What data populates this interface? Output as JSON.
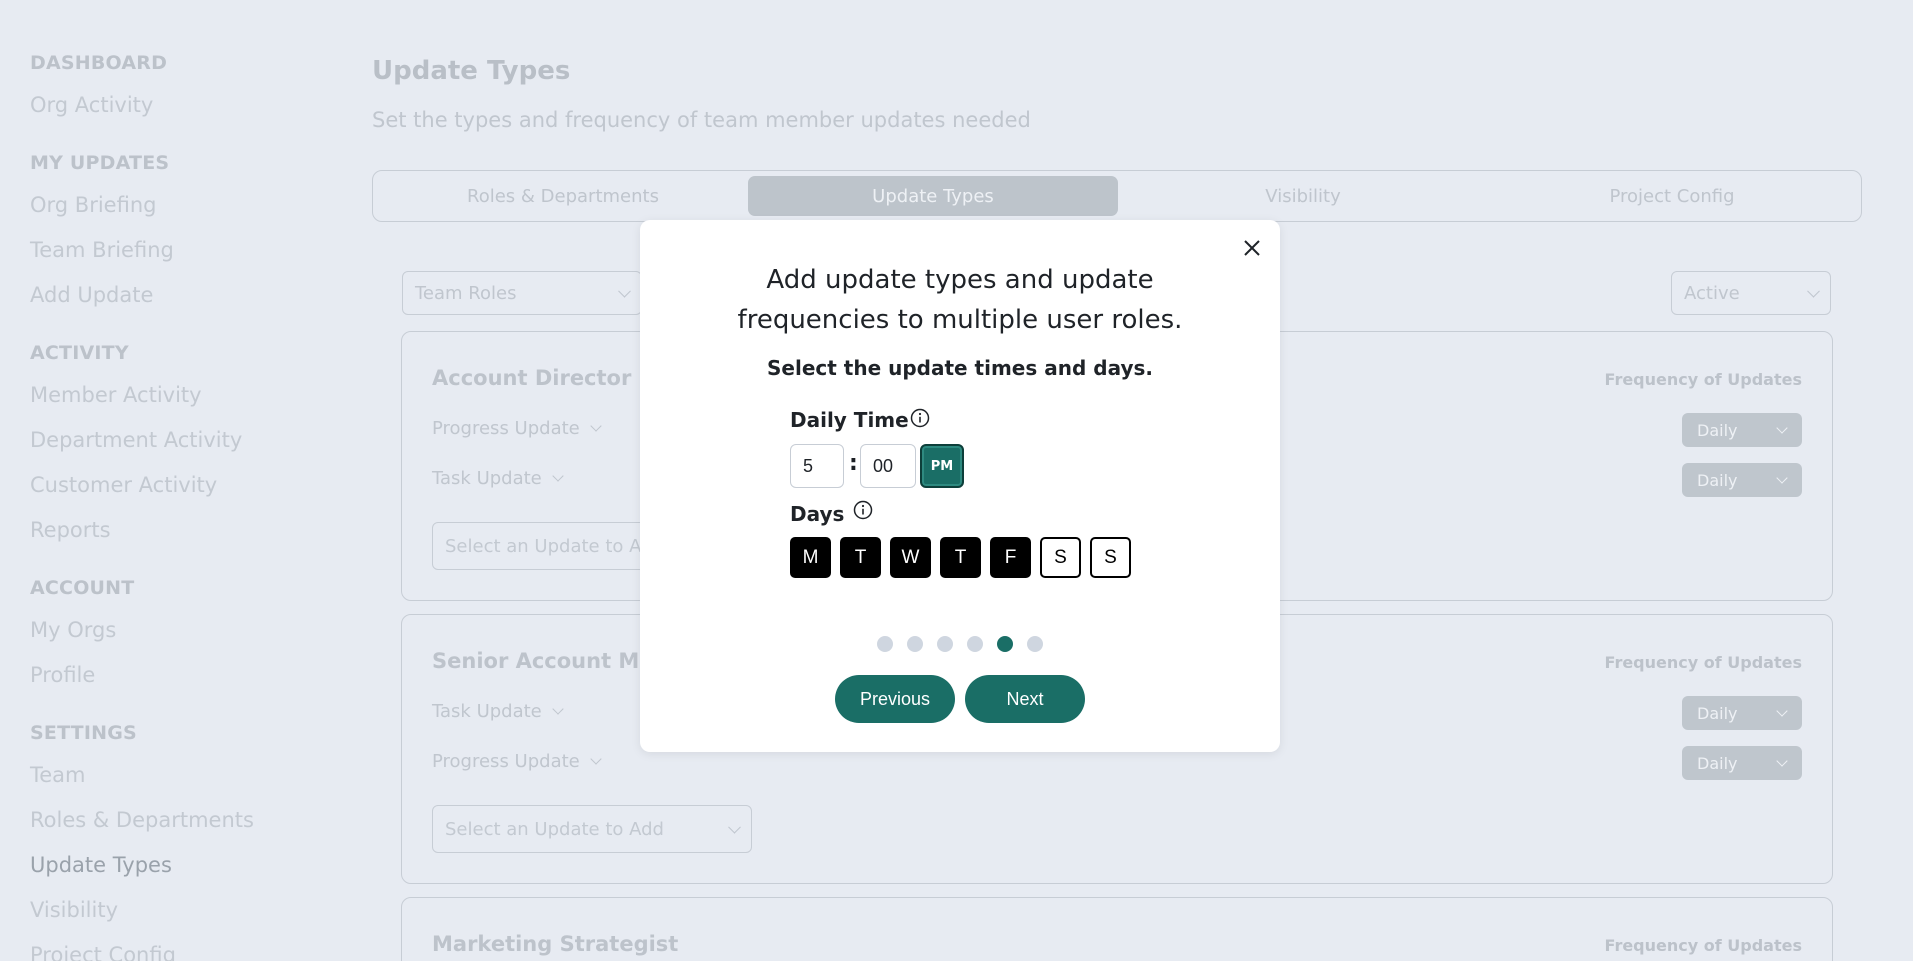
{
  "sidebar": {
    "sections": [
      {
        "heading": "DASHBOARD",
        "items": [
          "Org Activity"
        ]
      },
      {
        "heading": "MY UPDATES",
        "items": [
          "Org Briefing",
          "Team Briefing",
          "Add Update"
        ]
      },
      {
        "heading": "ACTIVITY",
        "items": [
          "Member Activity",
          "Department Activity",
          "Customer Activity",
          "Reports"
        ]
      },
      {
        "heading": "ACCOUNT",
        "items": [
          "My Orgs",
          "Profile"
        ]
      },
      {
        "heading": "SETTINGS",
        "items": [
          "Team",
          "Roles & Departments",
          "Update Types",
          "Visibility",
          "Project Config"
        ]
      }
    ],
    "active_item": "Update Types"
  },
  "header": {
    "title": "Update Types",
    "subtitle": "Set the types and frequency of team member updates needed"
  },
  "tabs": [
    "Roles & Departments",
    "Update Types",
    "Visibility",
    "Project Config"
  ],
  "active_tab": "Update Types",
  "filters": {
    "role_filter": "Team Roles",
    "status_filter": "Active"
  },
  "cards": [
    {
      "title": "Account Director",
      "frequency_label": "Frequency of Updates",
      "updates": [
        {
          "name": "Progress Update",
          "frequency": "Daily"
        },
        {
          "name": "Task Update",
          "frequency": "Daily"
        }
      ],
      "add_placeholder": "Select an Update to Add"
    },
    {
      "title": "Senior Account Manager",
      "frequency_label": "Frequency of Updates",
      "updates": [
        {
          "name": "Task Update",
          "frequency": "Daily"
        },
        {
          "name": "Progress Update",
          "frequency": "Daily"
        }
      ],
      "add_placeholder": "Select an Update to Add"
    },
    {
      "title": "Marketing Strategist",
      "frequency_label": "Frequency of Updates"
    }
  ],
  "modal": {
    "title_line1": "Add update types and update",
    "title_line2": "frequencies to multiple user roles.",
    "subtitle": "Select the update times and days.",
    "daily_time_label": "Daily Time",
    "hour": "5",
    "separator": ":",
    "minute": "00",
    "meridiem": "PM",
    "days_label": "Days",
    "days": [
      {
        "label": "M",
        "selected": true
      },
      {
        "label": "T",
        "selected": true
      },
      {
        "label": "W",
        "selected": true
      },
      {
        "label": "T",
        "selected": true
      },
      {
        "label": "F",
        "selected": true
      },
      {
        "label": "S",
        "selected": false
      },
      {
        "label": "S",
        "selected": false
      }
    ],
    "step_current": 5,
    "step_total": 6,
    "previous_label": "Previous",
    "next_label": "Next"
  },
  "colors": {
    "accent": "#1a6e66",
    "background": "#e7ebf2"
  },
  "icons": [
    "close-icon",
    "info-icon",
    "chevron-down-icon"
  ]
}
